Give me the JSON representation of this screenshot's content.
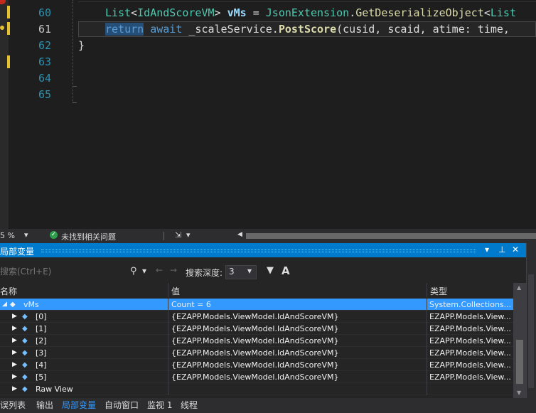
{
  "editor": {
    "lines": [
      {
        "no": "60",
        "code_parts": [
          "List",
          "<",
          "IdAndScoreVM",
          "> ",
          "vMs",
          " = ",
          "JsonExtension",
          ".",
          "GetDeserializeObject",
          "<",
          "List"
        ]
      },
      {
        "no": "61",
        "return_kw": "return",
        "await_kw": "await",
        "rest1": " _scaleService.",
        "method": "PostScore",
        "rest2": "(cusid, scaid, atime: time,"
      },
      {
        "no": "62",
        "text": "}"
      },
      {
        "no": "63",
        "text": ""
      },
      {
        "no": "64",
        "text": ""
      },
      {
        "no": "65",
        "text": ""
      }
    ]
  },
  "statusbar": {
    "zoom": "5 %",
    "issues": "未找到相关问题"
  },
  "locals": {
    "title": "局部变量",
    "search_placeholder": "搜索(Ctrl+E)",
    "search_depth_label": "搜索深度:",
    "search_depth_value": "3",
    "columns": [
      "名称",
      "值",
      "类型"
    ],
    "rows": [
      {
        "name": "vMs",
        "value": "Count = 6",
        "type": "System.Collections....",
        "expanded": true,
        "selected": true
      },
      {
        "name": "[0]",
        "value": "{EZAPP.Models.ViewModel.IdAndScoreVM}",
        "type": "EZAPP.Models.View..."
      },
      {
        "name": "[1]",
        "value": "{EZAPP.Models.ViewModel.IdAndScoreVM}",
        "type": "EZAPP.Models.View..."
      },
      {
        "name": "[2]",
        "value": "{EZAPP.Models.ViewModel.IdAndScoreVM}",
        "type": "EZAPP.Models.View..."
      },
      {
        "name": "[3]",
        "value": "{EZAPP.Models.ViewModel.IdAndScoreVM}",
        "type": "EZAPP.Models.View..."
      },
      {
        "name": "[4]",
        "value": "{EZAPP.Models.ViewModel.IdAndScoreVM}",
        "type": "EZAPP.Models.View..."
      },
      {
        "name": "[5]",
        "value": "{EZAPP.Models.ViewModel.IdAndScoreVM}",
        "type": "EZAPP.Models.View..."
      },
      {
        "name": "Raw View",
        "value": "",
        "type": ""
      }
    ]
  },
  "bottom_tabs": [
    "错误列表",
    "输出",
    "局部变量",
    "自动窗口",
    "监视 1",
    "线程"
  ],
  "active_tab": "局部变量",
  "colors": {
    "accent": "#007acc",
    "selection": "#3399ff",
    "marker": "#e6c02e"
  }
}
